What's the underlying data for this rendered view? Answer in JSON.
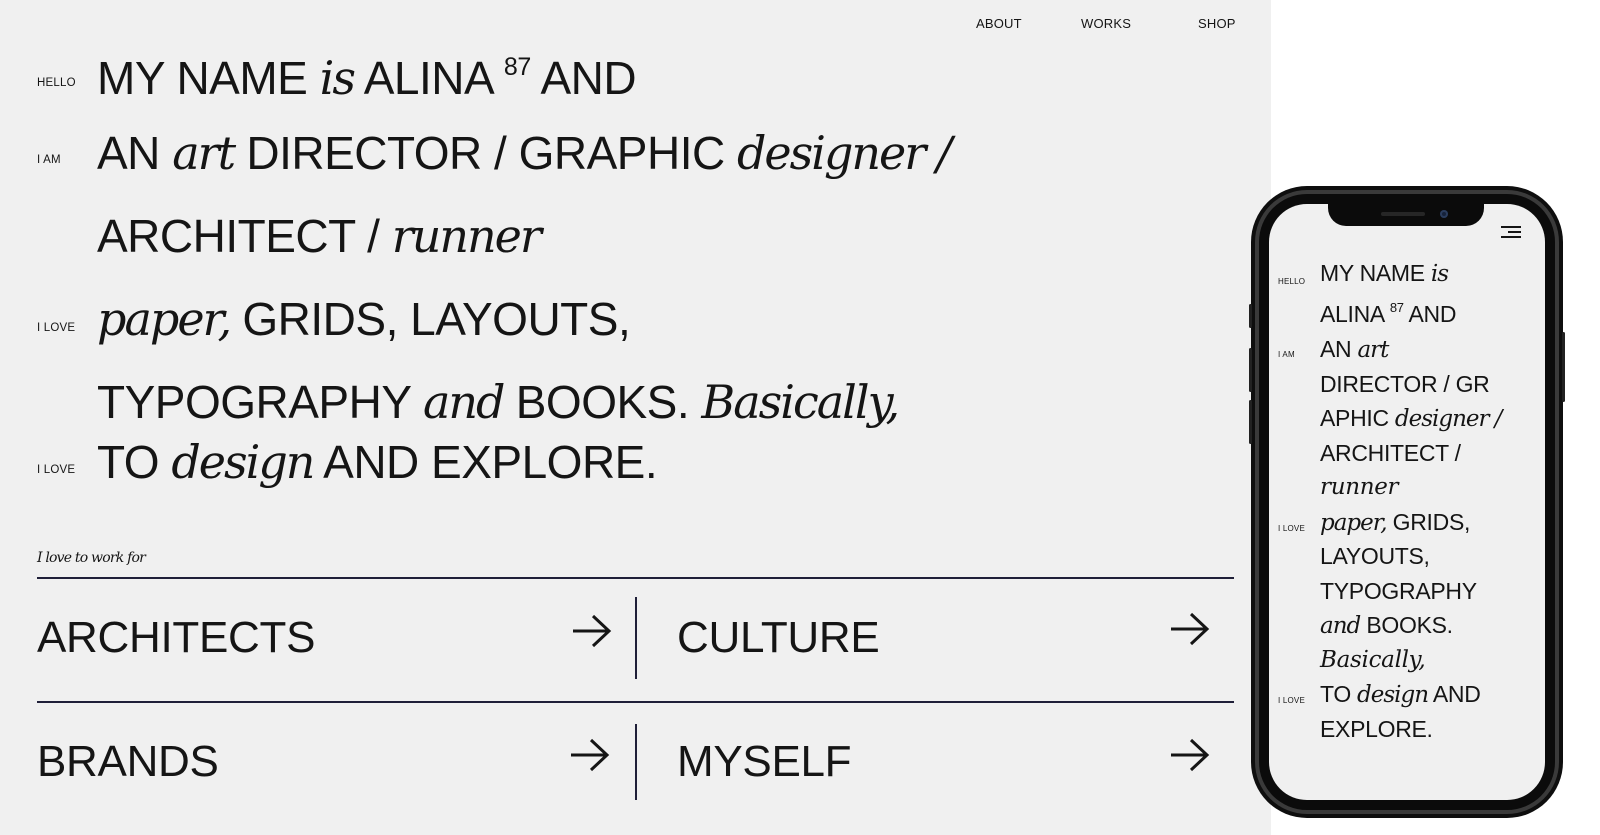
{
  "nav": {
    "about": "ABOUT",
    "works": "WORKS",
    "shop": "SHOP"
  },
  "intro": {
    "labels": {
      "hello": "HELLO",
      "i_am": "I AM",
      "i_love_1": "I LOVE",
      "i_love_2": "I LOVE"
    },
    "line1": {
      "a": "MY NAME",
      "b": "is",
      "c": "ALINA",
      "sup": "87",
      "d": "AND"
    },
    "line2": {
      "a": "AN",
      "b": "art",
      "c": "DIRECTOR / GRAPHIC",
      "d": "designer",
      "e": "/"
    },
    "line3": {
      "a": "ARCHITECT /",
      "b": "runner"
    },
    "line4": {
      "a": "paper,",
      "b": "GRIDS, LAYOUTS,"
    },
    "line5": {
      "a": "TYPOGRAPHY",
      "b": "and",
      "c": "BOOKS.",
      "d": "Basically,"
    },
    "line6": {
      "a": "TO",
      "b": "design",
      "c": "AND EXPLORE."
    }
  },
  "work": {
    "label": "I love to work for",
    "items": [
      "ARCHITECTS",
      "CULTURE",
      "BRANDS",
      "MYSELF"
    ],
    "arrow_icon": "arrow-right-icon"
  },
  "mobile": {
    "menu_icon": "hamburger-menu-icon",
    "labels": {
      "hello": "HELLO",
      "i_am": "I AM",
      "i_love_1": "I LOVE",
      "i_love_2": "I LOVE"
    },
    "l1": {
      "a": "MY NAME",
      "b": "is"
    },
    "l2": {
      "a": "ALINA",
      "sup": "87",
      "b": "AND"
    },
    "l3": {
      "a": "AN",
      "b": "art"
    },
    "l4": "DIRECTOR / GR",
    "l5": {
      "a": "APHIC",
      "b": "designer",
      "c": "/"
    },
    "l6": "ARCHITECT /",
    "l7": "runner",
    "l8": {
      "a": "paper,",
      "b": "GRIDS,"
    },
    "l9": "LAYOUTS,",
    "l10": "TYPOGRAPHY",
    "l11": {
      "a": "and",
      "b": "BOOKS."
    },
    "l12": "Basically,",
    "l13": {
      "a": "TO",
      "b": "design",
      "c": "AND"
    },
    "l14": "EXPLORE."
  },
  "colors": {
    "page_bg": "#f0f0f0",
    "text": "#151515",
    "rule": "#1f1f38"
  }
}
